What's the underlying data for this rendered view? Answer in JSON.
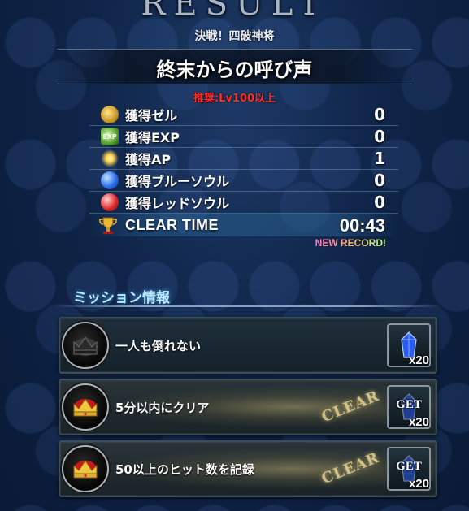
{
  "header": {
    "banner_text": "RESULT"
  },
  "battle": {
    "subtitle": "決戦！四破神将",
    "title": "終末からの呼び声",
    "recommended": "推奨:Lv100以上"
  },
  "rewards": [
    {
      "icon": "gil-coin-icon",
      "label": "獲得ゼル",
      "value": "0"
    },
    {
      "icon": "exp-icon",
      "label": "獲得EXP",
      "value": "0"
    },
    {
      "icon": "ap-star-icon",
      "label": "獲得AP",
      "value": "1"
    },
    {
      "icon": "blue-soul-icon",
      "label": "獲得ブルーソウル",
      "value": "0"
    },
    {
      "icon": "red-soul-icon",
      "label": "獲得レッドソウル",
      "value": "0"
    }
  ],
  "clear_time": {
    "icon": "trophy-icon",
    "label": "CLEAR TIME",
    "value": "00:43",
    "new_record": "NEW RECORD!"
  },
  "missions": {
    "header": "ミッション情報",
    "items": [
      {
        "description": "一人も倒れない",
        "cleared": false,
        "crown_icon": "black-crown-icon",
        "reward_icon": "blue-crystal-icon",
        "reward_qty": "x20",
        "reward_status": ""
      },
      {
        "description": "5分以内にクリア",
        "cleared": true,
        "stamp": "CLEAR",
        "crown_icon": "gold-crown-icon",
        "reward_icon": "blue-crystal-icon",
        "reward_qty": "x20",
        "reward_status": "GET"
      },
      {
        "description": "50以上のヒット数を記録",
        "cleared": true,
        "stamp": "CLEAR",
        "crown_icon": "gold-crown-icon",
        "reward_icon": "blue-crystal-icon",
        "reward_qty": "x20",
        "reward_status": "GET"
      }
    ]
  }
}
